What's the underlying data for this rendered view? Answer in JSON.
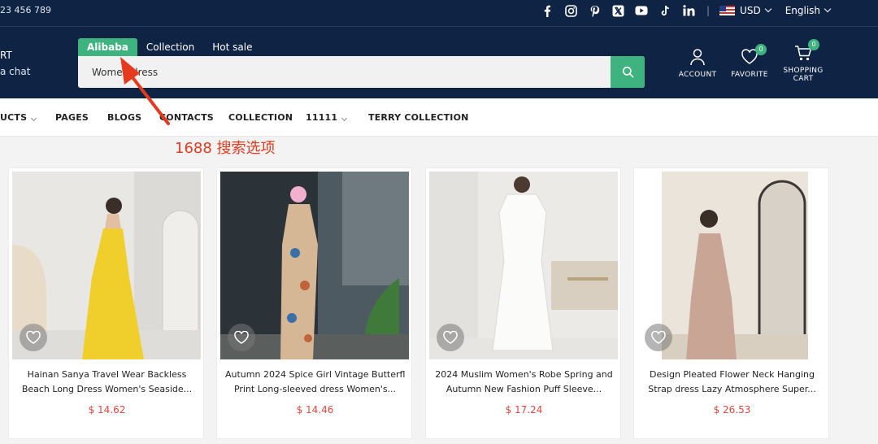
{
  "topbar": {
    "phone": "23 456 789",
    "socials": [
      "facebook-icon",
      "instagram-icon",
      "pinterest-icon",
      "x-icon",
      "youtube-icon",
      "tiktok-icon",
      "linkedin-icon"
    ],
    "currency": "USD",
    "language": "English"
  },
  "header": {
    "brand_line1": "RT",
    "brand_line2": "a chat",
    "search_tabs": [
      {
        "label": "Alibaba",
        "active": true
      },
      {
        "label": "Collection",
        "active": false
      },
      {
        "label": "Hot sale",
        "active": false
      }
    ],
    "search_value": "Women dress",
    "account_label": "ACCOUNT",
    "favorite_label": "FAVORITE",
    "favorite_count": "0",
    "cart_label_1": "SHOPPING",
    "cart_label_2": "CART",
    "cart_count": "0",
    "accent_color": "#3fb37f",
    "header_bg": "#0f2344"
  },
  "nav": {
    "items": [
      "UCTS",
      "PAGES",
      "BLOGS",
      "CONTACTS",
      "COLLECTION",
      "11111",
      "TERRY COLLECTION"
    ]
  },
  "annotation": {
    "text": "1688 搜索选项",
    "color": "#e63a1f"
  },
  "products": [
    {
      "line1": "Hainan Sanya Travel Wear Backless",
      "line2": "Beach Long Dress Women's Seaside...",
      "price": "$ 14.62"
    },
    {
      "line1": "Autumn 2024 Spice Girl Vintage Butterfly",
      "line2": "Print Long-sleeved dress Women's...",
      "price": "$ 14.46"
    },
    {
      "line1": "2024 Muslim Women's Robe Spring and",
      "line2": "Autumn New Fashion Puff Sleeve...",
      "price": "$ 17.24"
    },
    {
      "line1": "Design Pleated Flower Neck Hanging",
      "line2": "Strap dress Lazy Atmosphere Super...",
      "price": "$ 26.53"
    }
  ]
}
